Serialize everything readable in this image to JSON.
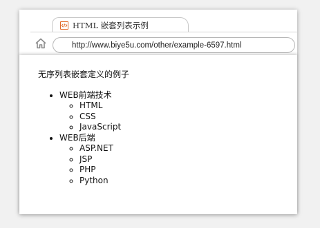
{
  "tab": {
    "title": "HTML 嵌套列表示例",
    "icon": "code-file-icon"
  },
  "toolbar": {
    "home_icon": "home-icon",
    "url": "http://www.biye5u.com/other/example-6597.html"
  },
  "page": {
    "heading": "无序列表嵌套定义的例子",
    "groups": [
      {
        "label": "WEB前端技术",
        "items": [
          "HTML",
          "CSS",
          "JavaScript"
        ]
      },
      {
        "label": "WEB后端",
        "items": [
          "ASP.NET",
          "JSP",
          "PHP",
          "Python"
        ]
      }
    ]
  },
  "colors": {
    "tab_icon": "#e06a2a",
    "page_background": "#f1f1f1"
  }
}
